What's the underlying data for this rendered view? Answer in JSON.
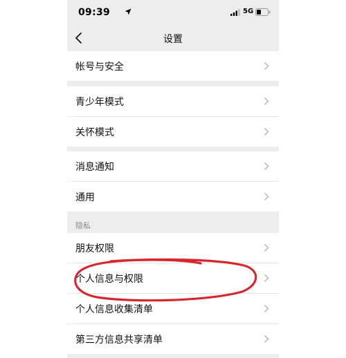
{
  "status_bar": {
    "time": "09:39",
    "network": "5G",
    "icons": [
      "location-arrow-icon",
      "signal-bars-icon",
      "battery-icon"
    ]
  },
  "nav": {
    "title": "设置",
    "back_icon": "chevron-left-icon"
  },
  "groups": [
    {
      "items": [
        {
          "label": "帐号与安全"
        }
      ]
    },
    {
      "items": [
        {
          "label": "青少年模式"
        },
        {
          "label": "关怀模式"
        }
      ]
    },
    {
      "items": [
        {
          "label": "消息通知"
        },
        {
          "label": "通用"
        }
      ]
    },
    {
      "header": "隐私",
      "items": [
        {
          "label": "朋友权限"
        },
        {
          "label": "个人信息与权限",
          "highlighted": true
        },
        {
          "label": "个人信息收集清单"
        },
        {
          "label": "第三方信息共享清单"
        }
      ]
    }
  ],
  "colors": {
    "background": "#ededed",
    "cell": "#ffffff",
    "annotation": "#d8262e"
  }
}
